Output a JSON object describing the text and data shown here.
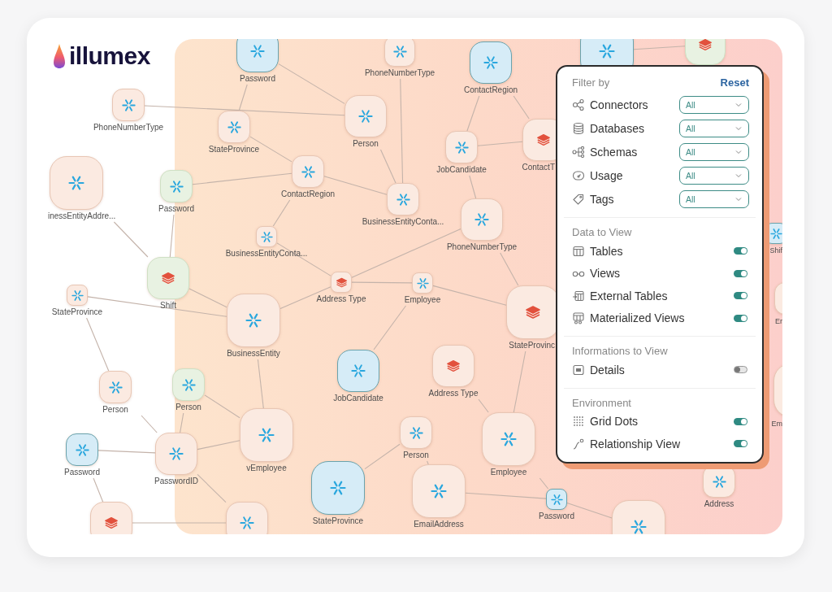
{
  "logo": {
    "text": "illumex"
  },
  "nodes": [
    {
      "label": "Password",
      "color": "#d6ecf7",
      "kind": "snowflake"
    },
    {
      "label": "PhoneNumberType",
      "color": "#fbeae1",
      "kind": "snowflake"
    },
    {
      "label": "ContactRegion",
      "color": "#d6ecf7",
      "kind": "snowflake"
    },
    {
      "color": "#d6ecf7",
      "kind": "snowflake"
    },
    {
      "color": "#e8f2e2",
      "kind": "layers"
    },
    {
      "label": "PhoneNumberType",
      "color": "#fbeae1",
      "kind": "snowflake"
    },
    {
      "label": "StateProvince",
      "color": "#fbeae1",
      "kind": "snowflake"
    },
    {
      "label": "Person",
      "color": "#fbeae1",
      "kind": "snowflake"
    },
    {
      "label": "JobCandidate",
      "color": "#fbeae1",
      "kind": "snowflake"
    },
    {
      "label": "ContactT",
      "color": "#fbeae1",
      "kind": "layers"
    },
    {
      "label": "inessEntityAddre...",
      "color": "#fbeae1",
      "kind": "snowflake"
    },
    {
      "label": "Password",
      "color": "#e8f2e2",
      "kind": "snowflake"
    },
    {
      "label": "ContactRegion",
      "color": "#fbeae1",
      "kind": "snowflake"
    },
    {
      "label": "BusinessEntityConta...",
      "color": "#fbeae1",
      "kind": "snowflake"
    },
    {
      "label": "PhoneNumberType",
      "color": "#fbeae1",
      "kind": "snowflake"
    },
    {
      "label": "BusinessEntityConta...",
      "color": "#fbeae1",
      "kind": "snowflake"
    },
    {
      "label": "Shift",
      "color": "#e8f2e2",
      "kind": "layers"
    },
    {
      "label": "StateProvince",
      "color": "#fbeae1",
      "kind": "snowflake"
    },
    {
      "label": "Address Type",
      "color": "#fbeae1",
      "kind": "layers"
    },
    {
      "label": "Employee",
      "color": "#fbeae1",
      "kind": "snowflake"
    },
    {
      "label": "BusinessEntity",
      "color": "#fbeae1",
      "kind": "snowflake"
    },
    {
      "label": "StateProvinc",
      "color": "#fbeae1",
      "kind": "layers"
    },
    {
      "label": "JobCandidate",
      "color": "#d6ecf7",
      "kind": "snowflake"
    },
    {
      "label": "Address Type",
      "color": "#fbeae1",
      "kind": "layers"
    },
    {
      "label": "Person",
      "color": "#fbeae1",
      "kind": "snowflake"
    },
    {
      "label": "Person",
      "color": "#e8f2e2",
      "kind": "snowflake"
    },
    {
      "label": "vEmployee",
      "color": "#fbeae1",
      "kind": "snowflake"
    },
    {
      "label": "Person",
      "color": "#fbeae1",
      "kind": "snowflake"
    },
    {
      "label": "Employee",
      "color": "#fbeae1",
      "kind": "snowflake"
    },
    {
      "label": "Password",
      "color": "#d6ecf7",
      "kind": "snowflake"
    },
    {
      "label": "PasswordID",
      "color": "#fbeae1",
      "kind": "snowflake"
    },
    {
      "label": "StateProvince",
      "color": "#d6ecf7",
      "kind": "snowflake"
    },
    {
      "label": "EmailAddress",
      "color": "#fbeae1",
      "kind": "snowflake"
    },
    {
      "label": "Password",
      "color": "#d6ecf7",
      "kind": "snowflake"
    },
    {
      "color": "#fbeae1",
      "kind": "snowflake"
    },
    {
      "label": "Address",
      "color": "#fbeae1",
      "kind": "snowflake"
    },
    {
      "color": "#fbeae1",
      "kind": "layers"
    },
    {
      "color": "#fbeae1",
      "kind": "snowflake"
    },
    {
      "label": "Shif",
      "color": "#d6ecf7",
      "kind": "snowflake"
    },
    {
      "label": "Er",
      "color": "#fbeae1"
    },
    {
      "label": "Em",
      "color": "#fbeae1"
    }
  ],
  "filter_panel": {
    "title": "Filter by",
    "reset": "Reset",
    "filters": [
      {
        "label": "Connectors",
        "value": "All"
      },
      {
        "label": "Databases",
        "value": "All"
      },
      {
        "label": "Schemas",
        "value": "All"
      },
      {
        "label": "Usage",
        "value": "All"
      },
      {
        "label": "Tags",
        "value": "All"
      }
    ],
    "sections": [
      {
        "title": "Data to View",
        "toggles": [
          {
            "label": "Tables",
            "on": true
          },
          {
            "label": "Views",
            "on": true
          },
          {
            "label": "External Tables",
            "on": true
          },
          {
            "label": "Materialized Views",
            "on": true
          }
        ]
      },
      {
        "title": "Informations to View",
        "toggles": [
          {
            "label": "Details",
            "on": false
          }
        ]
      },
      {
        "title": "Environment",
        "toggles": [
          {
            "label": "Grid Dots",
            "on": true
          },
          {
            "label": "Relationship View",
            "on": true
          }
        ]
      }
    ]
  }
}
